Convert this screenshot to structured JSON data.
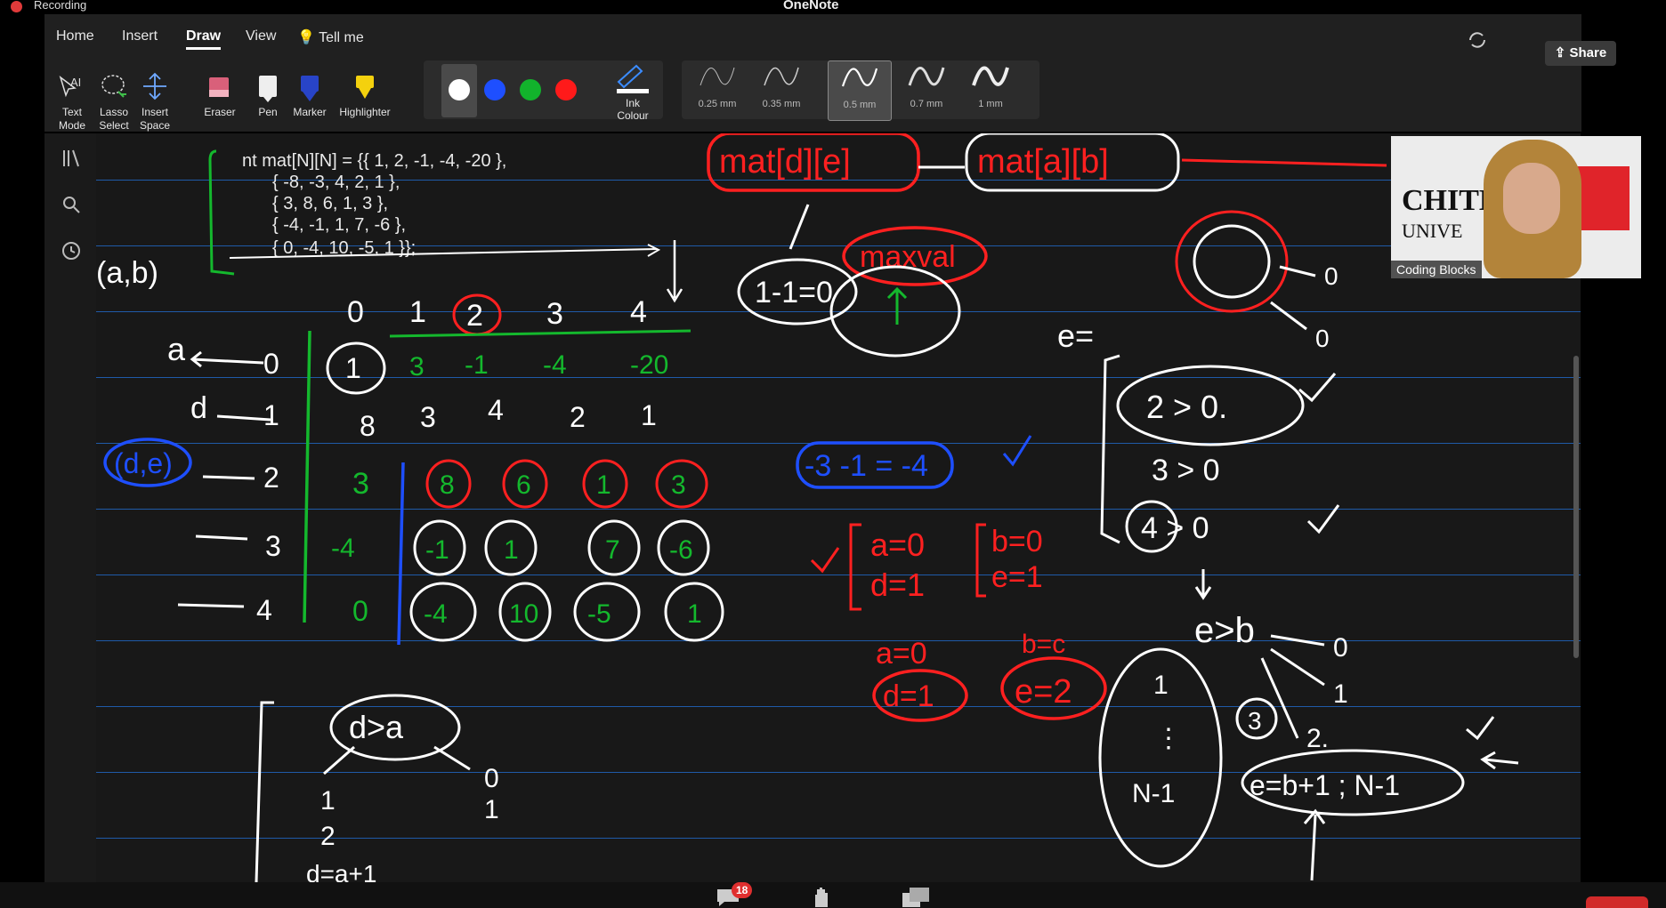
{
  "titlebar": {
    "recording_label": "Recording",
    "app_title": "OneNote"
  },
  "ribbon": {
    "tabs": [
      "Home",
      "Insert",
      "Draw",
      "View",
      "Tell me"
    ],
    "active_tab": "Draw",
    "tools": [
      "Text Mode",
      "Lasso Select",
      "Insert Space",
      "Eraser",
      "Pen",
      "Marker",
      "Highlighter"
    ],
    "pen_colors": [
      "#ffffff",
      "#1e4fff",
      "#12b32c",
      "#ff1a1a"
    ],
    "ink_colour_label": "Ink Colour",
    "thicknesses": [
      "0.25 mm",
      "0.35 mm",
      "0.5 mm",
      "0.7 mm",
      "1 mm"
    ],
    "selected_thickness": "0.5 mm",
    "share_label": "Share"
  },
  "code": {
    "line1": "nt mat[N][N] = {{ 1, 2, -1, -4, -20 },",
    "line2": "{ -8, -3, 4, 2, 1 },",
    "line3": "{ 3, 8, 6, 1, 3 },",
    "line4": "{ -4, -1, 1, 7, -6 },",
    "line5": "{ 0, -4, 10, -5, 1 }};"
  },
  "ink": {
    "ab": "(a,b)",
    "de_blue": "(d,e)",
    "col_headers": [
      "0",
      "1",
      "2",
      "3",
      "4"
    ],
    "row_labels": [
      "0",
      "1",
      "2",
      "3",
      "4"
    ],
    "a_arrow": "a",
    "d_arrow": "d",
    "row0": [
      "1",
      "3",
      "-1",
      "-4",
      "-20"
    ],
    "row1": [
      "8",
      "3",
      "4",
      "2",
      "1"
    ],
    "row2": [
      "3",
      "8",
      "6",
      "1",
      "3"
    ],
    "row3": [
      "-4",
      "-1",
      "1",
      "7",
      "-6"
    ],
    "row4": [
      "0",
      "-4",
      "10",
      "-5",
      "1"
    ],
    "top_formula_1": "mat[d][e]",
    "top_formula_2": "mat[a][b]",
    "maxval": "maxval",
    "one_minus_one": "1-1=0",
    "blue_eq": "-3 -1 = -4",
    "red_a0": "a=0",
    "red_d1": "d=1",
    "red_b0": "b=0",
    "red_e1": "e=1",
    "red_a0b": "a=0",
    "red_d1b": "d=1",
    "red_bc": "b=c",
    "red_e2": "e=2",
    "right_e": "e=",
    "cmp1": "2 > 0.",
    "cmp2": "3 > 0",
    "cmp3": "4 > 0",
    "e_gt_b": "e>b",
    "e_b1": "e=b+1 ; N-1",
    "branch_0": "0",
    "branch_1": "1",
    "branch_2": "2.",
    "branch_3": "3",
    "col_1": "1",
    "col_dots": "⋮",
    "col_n1": "N-1",
    "d_gt_a": "d>a",
    "d_branch0": "0",
    "d_branch1": "1",
    "d_one": "1",
    "d_two": "2",
    "d_eq": "d=a+1"
  },
  "video": {
    "name": "Coding Blocks",
    "banner": "CHITK",
    "banner2": "UNIVE"
  },
  "bottom": {
    "chat_badge": "18"
  }
}
